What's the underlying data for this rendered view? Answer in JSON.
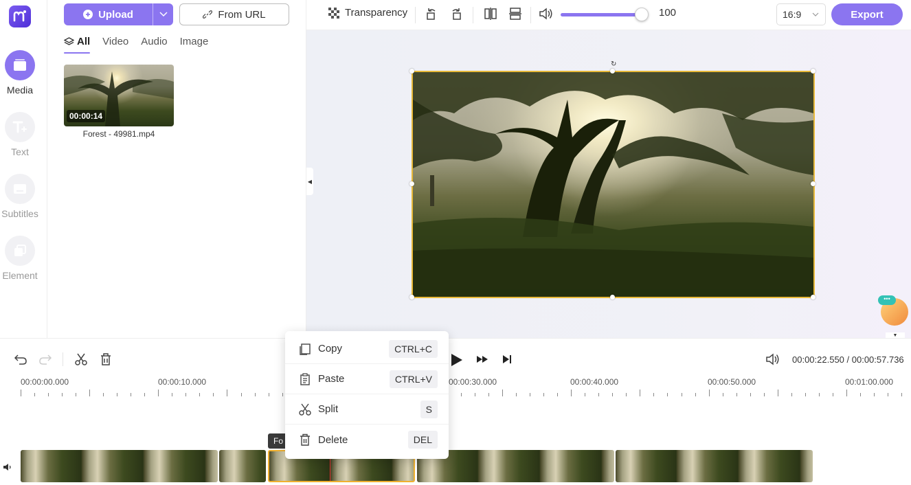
{
  "rail": {
    "items": [
      {
        "label": "Media",
        "active": true
      },
      {
        "label": "Text",
        "active": false
      },
      {
        "label": "Subtitles",
        "active": false
      },
      {
        "label": "Element",
        "active": false
      }
    ]
  },
  "media": {
    "upload_label": "Upload",
    "from_url_label": "From URL",
    "tabs": [
      "All",
      "Video",
      "Audio",
      "Image"
    ],
    "active_tab": "All",
    "items": [
      {
        "name": "Forest - 49981.mp4",
        "duration": "00:00:14"
      }
    ]
  },
  "toolbar": {
    "transparency_label": "Transparency",
    "volume_value": "100",
    "volume_level": 1.0,
    "aspect_ratio": "16:9",
    "export_label": "Export"
  },
  "timeline": {
    "current_time": "00:00:22.550",
    "total_time": "00:00:57.736",
    "ruler_labels": [
      "00:00:00.000",
      "00:00:10.000",
      "00:00:30.000",
      "00:00:40.000",
      "00:00:50.000",
      "00:01:00.000"
    ],
    "clip_tag": "Fo"
  },
  "context_menu": {
    "items": [
      {
        "label": "Copy",
        "shortcut": "CTRL+C"
      },
      {
        "label": "Paste",
        "shortcut": "CTRL+V"
      },
      {
        "label": "Split",
        "shortcut": "S"
      },
      {
        "label": "Delete",
        "shortcut": "DEL"
      }
    ]
  },
  "colors": {
    "accent": "#8b75f0",
    "selection": "#f0b02f",
    "playhead": "#dd3333"
  }
}
